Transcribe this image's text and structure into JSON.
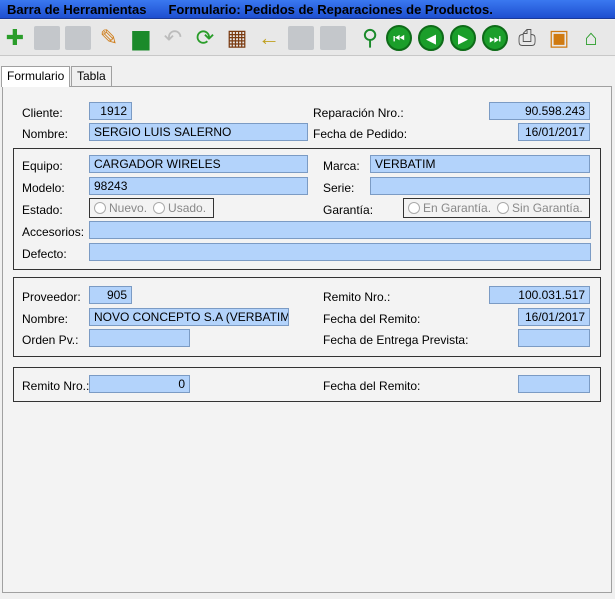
{
  "titlebar": {
    "left": "Barra de Herramientas",
    "right": "Formulario: Pedidos de Reparaciones de Productos."
  },
  "toolbar": {
    "buttons": [
      {
        "icon": "add-icon"
      },
      {
        "icon": "save-icon"
      },
      {
        "icon": "save-disabled-icon"
      },
      {
        "icon": "edit-icon"
      },
      {
        "icon": "delete-icon"
      },
      {
        "icon": "undo-icon"
      },
      {
        "icon": "refresh-icon"
      },
      {
        "icon": "film-icon"
      },
      {
        "icon": "arrow-left-icon"
      },
      {
        "icon": "disabled-icon"
      },
      {
        "icon": "disabled-icon"
      },
      {
        "icon": "search-icon"
      },
      {
        "icon": "first-icon"
      },
      {
        "icon": "prev-icon"
      },
      {
        "icon": "next-icon"
      },
      {
        "icon": "last-icon"
      },
      {
        "icon": "printer-icon"
      },
      {
        "icon": "gift-icon"
      },
      {
        "icon": "home-icon"
      }
    ]
  },
  "tabs": [
    {
      "label": "Formulario"
    },
    {
      "label": "Tabla"
    }
  ],
  "header": {
    "cliente_label": "Cliente:",
    "cliente_value": "1912",
    "reparacion_label": "Reparación Nro.:",
    "reparacion_value": "90.598.243",
    "nombre_label": "Nombre:",
    "nombre_value": "SERGIO LUIS SALERNO",
    "fecha_pedido_label": "Fecha de Pedido:",
    "fecha_pedido_value": "16/01/2017"
  },
  "equipo": {
    "equipo_label": "Equipo:",
    "equipo_value": "CARGADOR WIRELES",
    "marca_label": "Marca:",
    "marca_value": "VERBATIM",
    "modelo_label": "Modelo:",
    "modelo_value": "98243",
    "serie_label": "Serie:",
    "serie_value": "",
    "estado_label": "Estado:",
    "estado_options": [
      "Nuevo.",
      "Usado."
    ],
    "garantia_label": "Garantía:",
    "garantia_options": [
      "En Garantía.",
      "Sin Garantía."
    ],
    "accesorios_label": "Accesorios:",
    "accesorios_value": "",
    "defecto_label": "Defecto:",
    "defecto_value": ""
  },
  "proveedor": {
    "proveedor_label": "Proveedor:",
    "proveedor_value": "905",
    "remito_label": "Remito Nro.:",
    "remito_value": "100.031.517",
    "nombre_label": "Nombre:",
    "nombre_value": "NOVO CONCEPTO S.A (VERBATIM)",
    "fecha_remito_label": "Fecha del Remito:",
    "fecha_remito_value": "16/01/2017",
    "orden_label": "Orden Pv.:",
    "orden_value": "",
    "entrega_label": "Fecha de Entrega Prevista:",
    "entrega_value": ""
  },
  "remito": {
    "remito_label": "Remito Nro.:",
    "remito_value": "0",
    "fecha_label": "Fecha del Remito:",
    "fecha_value": ""
  }
}
